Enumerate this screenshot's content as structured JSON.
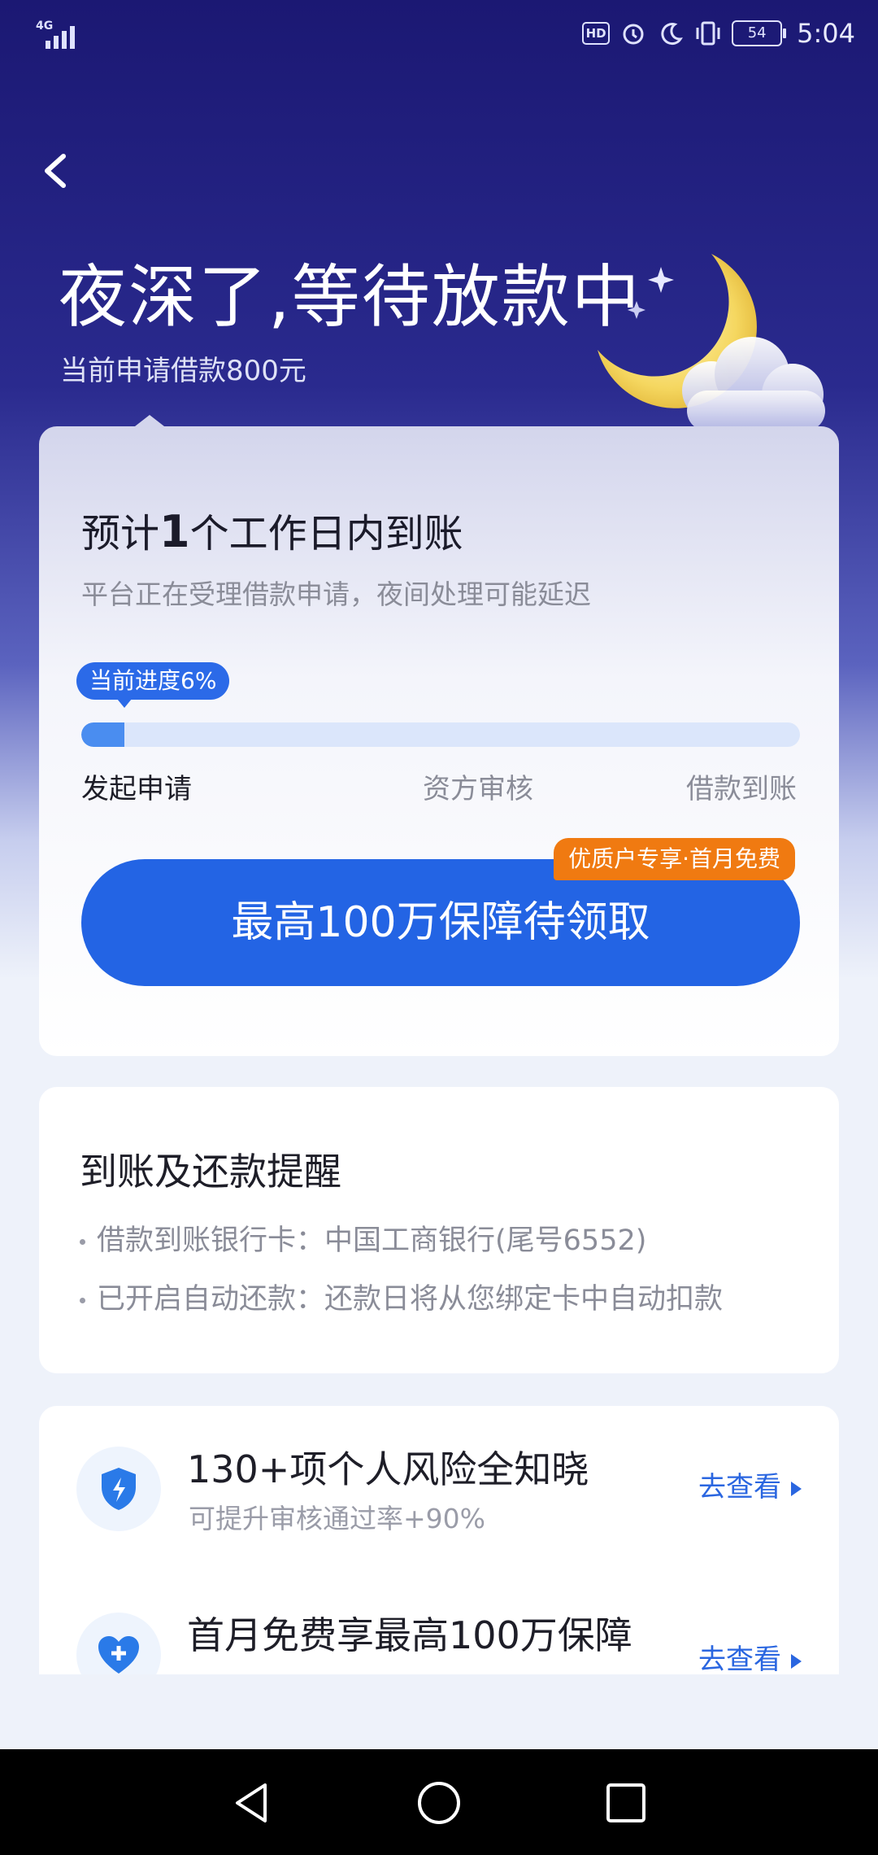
{
  "status_bar": {
    "network": "4G",
    "hd_label": "HD",
    "battery": "54",
    "time": "5:04",
    "icons": [
      "signal-icon",
      "hd-icon",
      "alarm-icon",
      "moon-icon",
      "vibrate-icon",
      "battery-icon"
    ]
  },
  "header": {
    "title": "夜深了,等待放款中",
    "subtitle": "当前申请借款800元"
  },
  "progress_card": {
    "eta_prefix": "预计",
    "eta_number": "1",
    "eta_suffix": "个工作日内到账",
    "description": "平台正在受理借款申请，夜间处理可能延迟",
    "progress_label": "当前进度6%",
    "progress_percent": 6,
    "steps": [
      "发起申请",
      "资方审核",
      "借款到账"
    ],
    "cta_label": "最高100万保障待领取",
    "promo_tag": "优质户专享·首月免费"
  },
  "reminder_card": {
    "title": "到账及还款提醒",
    "items": [
      "借款到账银行卡：中国工商银行(尾号6552)",
      "已开启自动还款：还款日将从您绑定卡中自动扣款"
    ]
  },
  "services": [
    {
      "icon": "shield-lightning-icon",
      "title": "130+项个人风险全知晓",
      "subtitle": "可提升审核通过率+90%",
      "link": "去查看"
    },
    {
      "icon": "heart-plus-icon",
      "title": "首月免费享最高100万保障",
      "subtitle": "",
      "link": "去查看"
    }
  ],
  "colors": {
    "primary": "#2364e4",
    "promo": "#f07a11",
    "header_bg": "#1b1873"
  }
}
